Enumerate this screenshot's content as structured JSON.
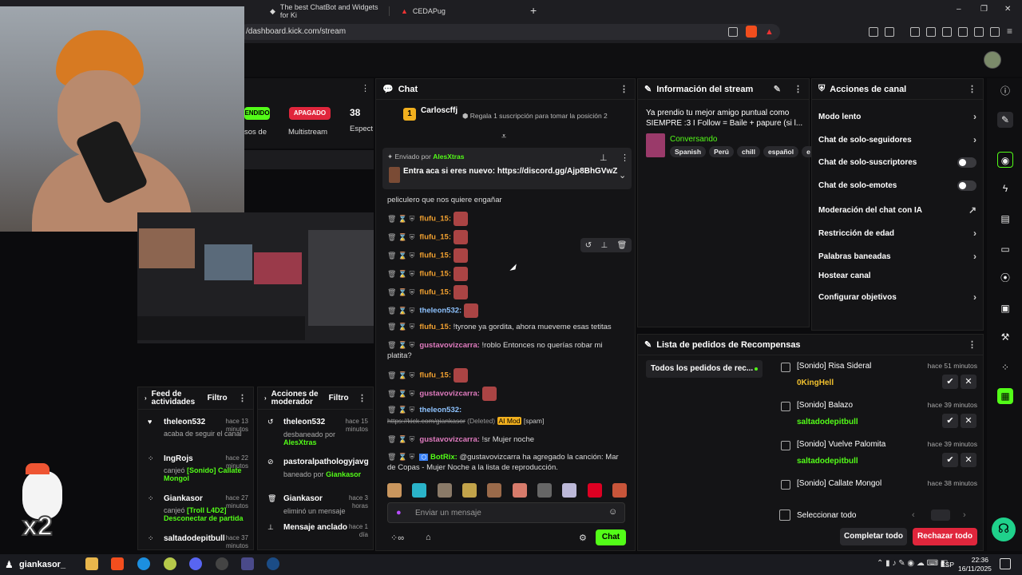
{
  "browser": {
    "tab1": "The best ChatBot and Widgets for Ki",
    "tab2": "CEDAPug",
    "new_tab": "+",
    "url": "/dashboard.kick.com/stream",
    "win_min": "–",
    "win_max": "❐",
    "win_close": "✕"
  },
  "stream_preview": {
    "btn1": "ENDIDO",
    "label1": "sos de",
    "btn2": "APAGADO",
    "label2": "Multistream",
    "count": "38",
    "count_label": "Espect"
  },
  "chat": {
    "title": "Chat",
    "top_user": "Carloscffj",
    "top_badge": "1",
    "top_text": "Regala 1 suscripción para tomar la posición 2",
    "pinned_label": "Enviado por",
    "pinned_user": "AlesXtras",
    "pinned_text": "Entra aca si eres nuevo: https://discord.gg/Ajp8BhGVwZ",
    "partial_line": "peliculero que nos quiere engañar",
    "messages": [
      {
        "user": "flufu_15:",
        "cls": "u-o",
        "text": "",
        "emote": true
      },
      {
        "user": "flufu_15:",
        "cls": "u-o",
        "text": "",
        "emote": true
      },
      {
        "user": "flufu_15:",
        "cls": "u-o",
        "text": "",
        "emote": true
      },
      {
        "user": "flufu_15:",
        "cls": "u-o",
        "text": "",
        "emote": true
      },
      {
        "user": "flufu_15:",
        "cls": "u-o",
        "text": "",
        "emote": true
      },
      {
        "user": "theleon532:",
        "cls": "u-b",
        "text": "",
        "emote": true
      },
      {
        "user": "flufu_15:",
        "cls": "u-o",
        "text": "!tyrone ya gordita, ahora mueveme esas tetitas",
        "emote": false
      },
      {
        "user": "gustavovizcarra:",
        "cls": "u-p",
        "text": "!roblo Entonces no querías robar mi platita?",
        "emote": false
      },
      {
        "user": "flufu_15:",
        "cls": "u-o",
        "text": "",
        "emote": true
      },
      {
        "user": "gustavovizcarra:",
        "cls": "u-p",
        "text": "",
        "emote": true
      },
      {
        "user": "theleon532:",
        "cls": "u-b",
        "text": "",
        "emote": false
      },
      {
        "user": "gustavovizcarra:",
        "cls": "u-p",
        "text": "!sr Mujer noche",
        "emote": false
      }
    ],
    "deleted_link": "https://kick.com/giankasor",
    "deleted_tag": "(Deleted)",
    "ai_mod": "AI Mod",
    "spam": "[spam]",
    "botrix_user": "BotRix:",
    "botrix_text": "@gustavovizcarra ha agregado la canción: Mar de Copas - Mujer Noche a la lista de reproducción.",
    "input_placeholder": "Enviar un mensaje",
    "send_label": "Chat"
  },
  "stream_info": {
    "title": "Información del stream",
    "text": "Ya prendio tu mejor amigo puntual como SIEMPRE :3 I Follow = Baile + papure (si l...",
    "category": "Conversando",
    "tags": [
      "Spanish",
      "Perú",
      "chill",
      "español",
      "e"
    ]
  },
  "channel_actions": {
    "title": "Acciones de canal",
    "items": [
      {
        "label": "Modo lento",
        "type": "arrow"
      },
      {
        "label": "Chat de solo-seguidores",
        "type": "arrow"
      },
      {
        "label": "Chat de solo-suscriptores",
        "type": "toggle"
      },
      {
        "label": "Chat de solo-emotes",
        "type": "toggle"
      },
      {
        "label": "Moderación del chat con IA",
        "type": "ext"
      },
      {
        "label": "Restricción de edad",
        "type": "arrow"
      },
      {
        "label": "Palabras baneadas",
        "type": "arrow"
      },
      {
        "label": "Hostear canal",
        "type": "none"
      },
      {
        "label": "Configurar objetivos",
        "type": "arrow"
      }
    ],
    "arrow_glyph": "›",
    "ext_glyph": "↗"
  },
  "activity_feed": {
    "title": "Feed de actividades",
    "filter": "Filtro",
    "items": [
      {
        "name": "theleon532",
        "time": "hace 13 minutos",
        "desc": "acaba de seguir el canal",
        "hl": ""
      },
      {
        "name": "IngRojs",
        "time": "hace 22 minutos",
        "desc": "canjeó",
        "hl": "[Sonido] Callate Mongol"
      },
      {
        "name": "Giankasor",
        "time": "hace 27 minutos",
        "desc": "canjeó",
        "hl": "[Troll L4D2] Desconectar de partida"
      },
      {
        "name": "saltadodepitbull",
        "time": "hace 37 minutos",
        "desc": "",
        "hl": ""
      }
    ]
  },
  "mod_actions": {
    "title": "Acciones de moderador",
    "filter": "Filtro",
    "items": [
      {
        "name": "theleon532",
        "time": "hace 15 minutos",
        "desc": "desbaneado por",
        "by": "AlesXtras"
      },
      {
        "name": "pastoralpathologyjavg",
        "time": "",
        "desc": "baneado por",
        "by": "Giankasor"
      },
      {
        "name": "Giankasor",
        "time": "hace 3 horas",
        "desc": "eliminó un mensaje",
        "by": ""
      },
      {
        "name": "Mensaje anclado",
        "time": "hace 1 día",
        "desc": "",
        "by": ""
      }
    ]
  },
  "rewards": {
    "title": "Lista de pedidos de Recompensas",
    "filter": "Todos los pedidos de rec...",
    "items": [
      {
        "title": "[Sonido] Risa Sideral",
        "user": "0KingHell",
        "time": "hace 51 minutos",
        "color": "#f2c12e"
      },
      {
        "title": "[Sonido] Balazo",
        "user": "saltadodepitbull",
        "time": "hace 39 minutos",
        "color": "#53fc18"
      },
      {
        "title": "[Sonido] Vuelve Palomita",
        "user": "saltadodepitbull",
        "time": "hace 39 minutos",
        "color": "#53fc18"
      },
      {
        "title": "[Sonido] Callate Mongol",
        "user": "",
        "time": "hace 38 minutos",
        "color": "#53fc18"
      }
    ],
    "select_all": "Seleccionar todo",
    "complete_all": "Completar todo",
    "reject_all": "Rechazar todo",
    "check_glyph": "✔",
    "x_glyph": "✕"
  },
  "taskbar": {
    "user": "giankasor_",
    "lang": "ESP",
    "time": "22:36",
    "date": "16/11/2025"
  },
  "overlay": {
    "mult": "x2"
  },
  "colors": {
    "accent": "#53fc18",
    "danger": "#e0263c",
    "bg": "#0b0b0d"
  }
}
